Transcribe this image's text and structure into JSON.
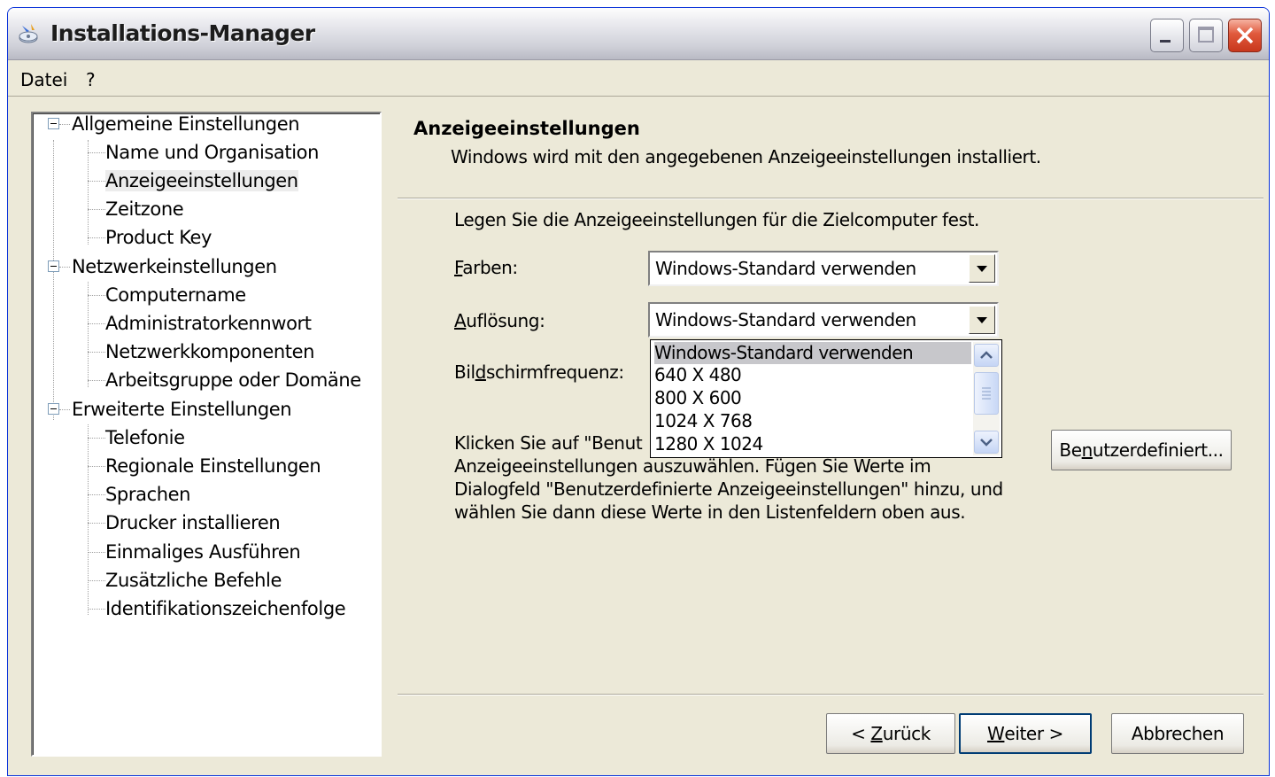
{
  "window": {
    "title": "Installations-Manager"
  },
  "menu": [
    "Datei",
    "?"
  ],
  "tree": {
    "groups": [
      {
        "label": "Allgemeine Einstellungen",
        "items": [
          "Name und Organisation",
          "Anzeigeeinstellungen",
          "Zeitzone",
          "Product Key"
        ]
      },
      {
        "label": "Netzwerkeinstellungen",
        "items": [
          "Computername",
          "Administratorkennwort",
          "Netzwerkkomponenten",
          "Arbeitsgruppe oder Domäne"
        ]
      },
      {
        "label": "Erweiterte Einstellungen",
        "items": [
          "Telefonie",
          "Regionale Einstellungen",
          "Sprachen",
          "Drucker installieren",
          "Einmaliges Ausführen",
          "Zusätzliche Befehle",
          "Identifikationszeichenfolge"
        ]
      }
    ],
    "selected": "Anzeigeeinstellungen"
  },
  "page": {
    "title": "Anzeigeeinstellungen",
    "subtitle": "Windows wird mit den angegebenen Anzeigeeinstellungen installiert.",
    "intro": "Legen Sie die Anzeigeeinstellungen für die Zielcomputer fest.",
    "fields": {
      "farben": {
        "label_accel": "F",
        "label_rest": "arben:",
        "value": "Windows-Standard verwenden"
      },
      "aufloesung": {
        "label_accel": "A",
        "label_rest": "uflösung:",
        "value": "Windows-Standard verwenden"
      },
      "frequenz": {
        "label_pre": "Bil",
        "label_accel": "d",
        "label_rest": "schirmfrequenz:"
      }
    },
    "dropdown_options": [
      "Windows-Standard verwenden",
      "640 X 480",
      "800 X 600",
      "1024 X 768",
      "1280 X 1024"
    ],
    "dropdown_selected_index": 0,
    "hint_lines": [
      "Klicken Sie auf \"Benut",
      "Anzeigeeinstellungen auszuwählen. Fügen Sie Werte im",
      "Dialogfeld \"Benutzerdefinierte Anzeigeeinstellungen\" hinzu, und",
      "wählen Sie dann diese Werte in den Listenfeldern oben aus."
    ],
    "custom_button": {
      "pre": "Be",
      "accel": "n",
      "rest": "utzerdefiniert..."
    }
  },
  "buttons": {
    "back": {
      "pre": "< ",
      "accel": "Z",
      "rest": "urück"
    },
    "next": {
      "pre": "",
      "accel": "W",
      "rest": "eiter >"
    },
    "cancel": "Abbrechen"
  }
}
